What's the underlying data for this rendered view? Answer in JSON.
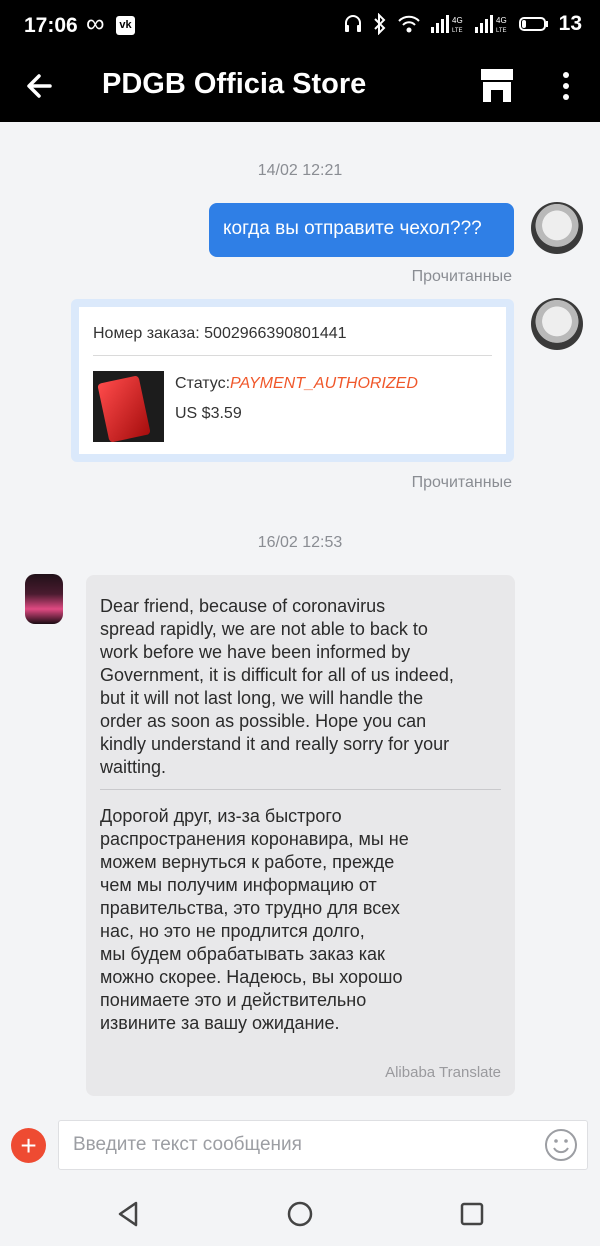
{
  "status_bar": {
    "time": "17:06",
    "battery": "13",
    "icons": [
      "infinity-icon",
      "vk-icon",
      "headphones-icon",
      "bluetooth-icon",
      "wifi-icon",
      "signal-4g-icon",
      "signal-4g-icon",
      "battery-icon"
    ]
  },
  "header": {
    "title": "PDGB Officia Store",
    "back_icon": "arrow-left-icon",
    "store_icon": "store-icon",
    "menu_icon": "more-vertical-icon"
  },
  "chat": {
    "messages": [
      {
        "timestamp": "14/02 12:21",
        "text": "когда вы отправите чехол???",
        "read_status": "Прочитанные"
      },
      {
        "order_label": "Номер заказа:",
        "order_number": "5002966390801441",
        "status_label": "Статус:",
        "status_value": "PAYMENT_AUTHORIZED",
        "price": "US $3.59",
        "read_status": "Прочитанные"
      },
      {
        "timestamp": "16/02 12:53",
        "original_text": "Dear friend, because of coronavirus\nspread rapidly, we are not able to back to\nwork before we have been informed by\nGovernment, it is difficult for all of us indeed,\nbut it will not last long, we will handle the\norder as soon as possible. Hope you can\nkindly understand it and really sorry for your\nwaitting.",
        "translated_text": "Дорогой друг, из-за быстрого\nраспространения коронавира, мы не\nможем вернуться к работе, прежде\nчем мы получим информацию от\nправительства, это трудно для всех\nнас, но это не продлится долго,\nмы будем обрабатывать заказ как\nможно скорее. Надеюсь, вы хорошо\nпонимаете это и действительно\nизвините за вашу ожидание.",
        "translate_source": "Alibaba Translate"
      }
    ]
  },
  "input": {
    "placeholder": "Введите текст сообщения",
    "value": "",
    "plus_icon": "plus-icon",
    "emoji_icon": "smiley-icon"
  },
  "nav": {
    "icons": [
      "back-triangle-icon",
      "home-circle-icon",
      "recents-square-icon"
    ]
  },
  "colors": {
    "accent_blue": "#2f7fe6",
    "status_orange": "#f0572a",
    "plus_red": "#ee4b32"
  }
}
